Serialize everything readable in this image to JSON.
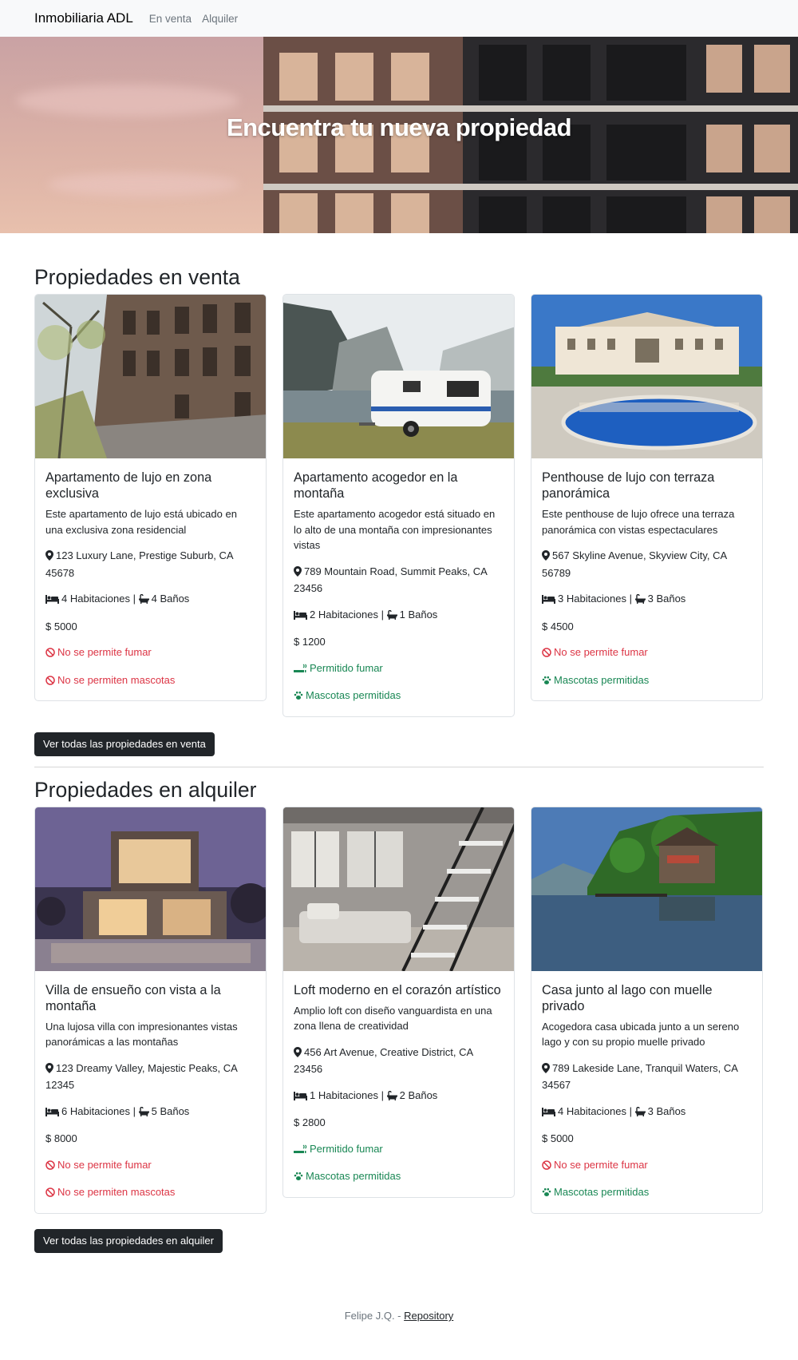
{
  "nav": {
    "brand": "Inmobiliaria ADL",
    "links": [
      "En venta",
      "Alquiler"
    ]
  },
  "hero": {
    "title": "Encuentra tu nueva propiedad"
  },
  "sale": {
    "title": "Propiedades en venta",
    "button": "Ver todas las propiedades en venta",
    "cards": [
      {
        "title": "Apartamento de lujo en zona exclusiva",
        "description": "Este apartamento de lujo está ubicado en una exclusiva zona residencial",
        "address": "123 Luxury Lane, Prestige Suburb, CA 45678",
        "rooms": "4 Habitaciones | ",
        "baths": "4 Baños",
        "price": "$ 5000",
        "smoking": "No se permite fumar",
        "pets": "No se permiten mascotas"
      },
      {
        "title": "Apartamento acogedor en la montaña",
        "description": "Este apartamento acogedor está situado en lo alto de una montaña con impresionantes vistas",
        "address": "789 Mountain Road, Summit Peaks, CA 23456",
        "rooms": "2 Habitaciones | ",
        "baths": "1 Baños",
        "price": "$ 1200",
        "smoking": "Permitido fumar",
        "pets": "Mascotas permitidas"
      },
      {
        "title": "Penthouse de lujo con terraza panorámica",
        "description": "Este penthouse de lujo ofrece una terraza panorámica con vistas espectaculares",
        "address": "567 Skyline Avenue, Skyview City, CA 56789",
        "rooms": "3 Habitaciones | ",
        "baths": "3 Baños",
        "price": "$ 4500",
        "smoking": "No se permite fumar",
        "pets": "Mascotas permitidas"
      }
    ]
  },
  "rent": {
    "title": "Propiedades en alquiler",
    "button": "Ver todas las propiedades en alquiler",
    "cards": [
      {
        "title": "Villa de ensueño con vista a la montaña",
        "description": "Una lujosa villa con impresionantes vistas panorámicas a las montañas",
        "address": "123 Dreamy Valley, Majestic Peaks, CA 12345",
        "rooms": "6 Habitaciones | ",
        "baths": "5 Baños",
        "price": "$ 8000",
        "smoking": "No se permite fumar",
        "pets": "No se permiten mascotas"
      },
      {
        "title": "Loft moderno en el corazón artístico",
        "description": "Amplio loft con diseño vanguardista en una zona llena de creatividad",
        "address": "456 Art Avenue, Creative District, CA 23456",
        "rooms": "1 Habitaciones | ",
        "baths": "2 Baños",
        "price": "$ 2800",
        "smoking": "Permitido fumar",
        "pets": "Mascotas permitidas"
      },
      {
        "title": "Casa junto al lago con muelle privado",
        "description": "Acogedora casa ubicada junto a un sereno lago y con su propio muelle privado",
        "address": "789 Lakeside Lane, Tranquil Waters, CA 34567",
        "rooms": "4 Habitaciones | ",
        "baths": "3 Baños",
        "price": "$ 5000",
        "smoking": "No se permite fumar",
        "pets": "Mascotas permitidas"
      }
    ]
  },
  "footer": {
    "text": "Felipe J.Q. - ",
    "link": "Repository"
  },
  "colors": {
    "danger": "#dc3545",
    "success": "#198754",
    "dark": "#212529"
  }
}
